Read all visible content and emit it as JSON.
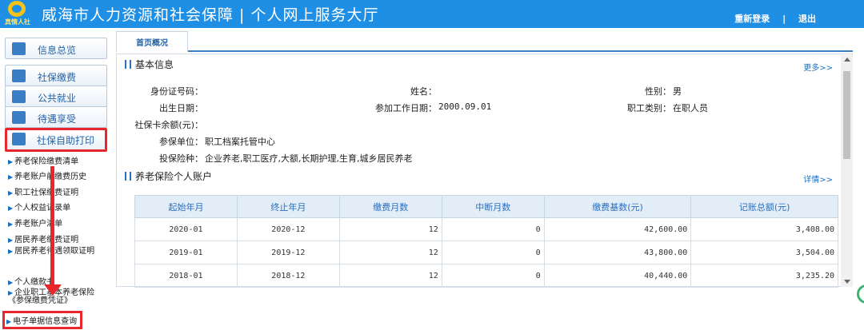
{
  "header": {
    "logo_text": "真情人社",
    "title": "威海市人力资源和社会保障 | 个人网上服务大厅",
    "relogin": "重新登录",
    "separator": "|",
    "logout": "退出"
  },
  "sidebar": {
    "menu": [
      {
        "label": "信息总览",
        "icon": "info-overview-icon"
      },
      {
        "label": "社保缴费",
        "icon": "payment-icon"
      },
      {
        "label": "公共就业",
        "icon": "employment-icon"
      },
      {
        "label": "待遇享受",
        "icon": "benefits-icon"
      },
      {
        "label": "社保自助打印",
        "icon": "printer-icon"
      }
    ],
    "sub_items": [
      "养老保险缴费清单",
      "养老账户前缴费历史",
      "职工社保缴费证明",
      "个人权益记录单",
      "养老账户清单",
      "居民养老缴费证明",
      "居民养老待遇领取证明",
      "个人缴款书",
      "企业职工基本养老保险《参保缴费凭证》",
      "电子单据信息查询"
    ]
  },
  "tabs": {
    "overview": "首页概况"
  },
  "basic_info": {
    "title": "基本信息",
    "more": "更多>>",
    "id_label": "身份证号码：",
    "id_value": "",
    "name_label": "姓名：",
    "name_value": "",
    "gender_label": "性别：",
    "gender_value": "男",
    "birth_label": "出生日期：",
    "birth_value": "",
    "work_date_label": "参加工作日期：",
    "work_date_value": "2000.09.01",
    "emp_type_label": "职工类别：",
    "emp_type_value": "在职人员",
    "card_balance_label": "社保卡余额(元)：",
    "card_balance_value": "",
    "unit_label": "参保单位：",
    "unit_value": "职工档案托管中心",
    "insurance_label": "投保险种：",
    "insurance_value": "企业养老,职工医疗,大额,长期护理,生育,城乡居民养老"
  },
  "pension": {
    "title": "养老保险个人账户",
    "detail": "详情>>",
    "headers": [
      "起始年月",
      "终止年月",
      "缴费月数",
      "中断月数",
      "缴费基数(元)",
      "记账总额(元)"
    ],
    "rows": [
      [
        "2020-01",
        "2020-12",
        "12",
        "0",
        "42,600.00",
        "3,408.00"
      ],
      [
        "2019-01",
        "2019-12",
        "12",
        "0",
        "43,800.00",
        "3,504.00"
      ],
      [
        "2018-01",
        "2018-12",
        "12",
        "0",
        "40,440.00",
        "3,235.20"
      ]
    ]
  },
  "colors": {
    "header": "#1f8fe6",
    "highlight": "#e8262c",
    "link": "#1a6fc0"
  }
}
